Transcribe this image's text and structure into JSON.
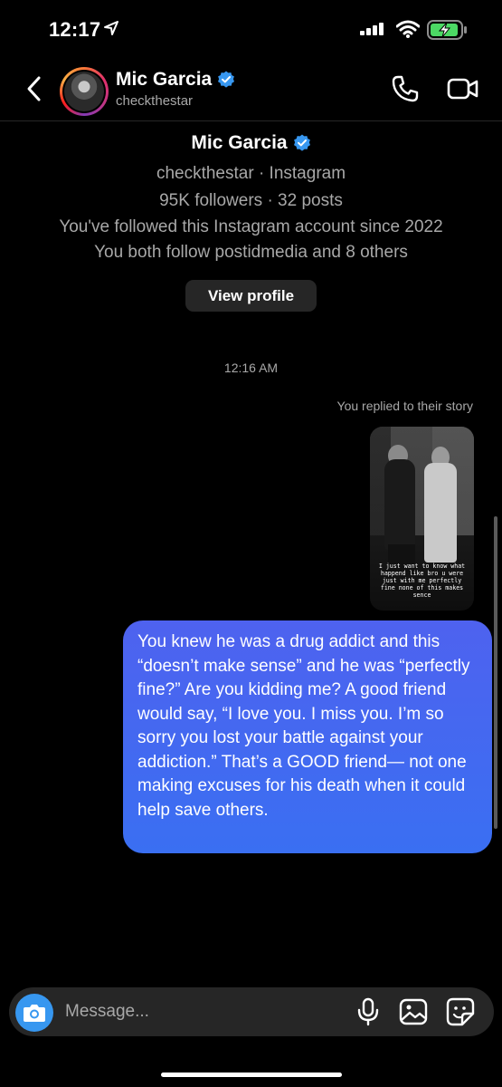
{
  "status_bar": {
    "time": "12:17"
  },
  "header": {
    "name": "Mic Garcia",
    "handle": "checkthestar"
  },
  "profile": {
    "name": "Mic Garcia",
    "line1": "checkthestar · Instagram",
    "line2": "95K followers · 32 posts",
    "line3": "You've followed this Instagram account since 2022",
    "line4": "You both follow postidmedia and 8 others",
    "view_profile_label": "View profile"
  },
  "thread": {
    "timestamp": "12:16 AM",
    "reply_note": "You replied to their story",
    "story_caption": "I just want to know what happend like bro u were just with me perfectly fine none of this makes sence",
    "message": "You knew he was a drug addict and this “doesn’t make sense” and he was “perfectly fine?” Are you kidding me? A good friend would say, “I love you. I miss you. I’m so sorry you lost your battle against your addiction.” That’s a GOOD friend— not one making excuses for his death when it could help save others."
  },
  "composer": {
    "placeholder": "Message..."
  },
  "colors": {
    "background": "#000000",
    "bubble": "#3d68f0",
    "verified": "#3797f0",
    "secondary_text": "#a8a8a8"
  }
}
